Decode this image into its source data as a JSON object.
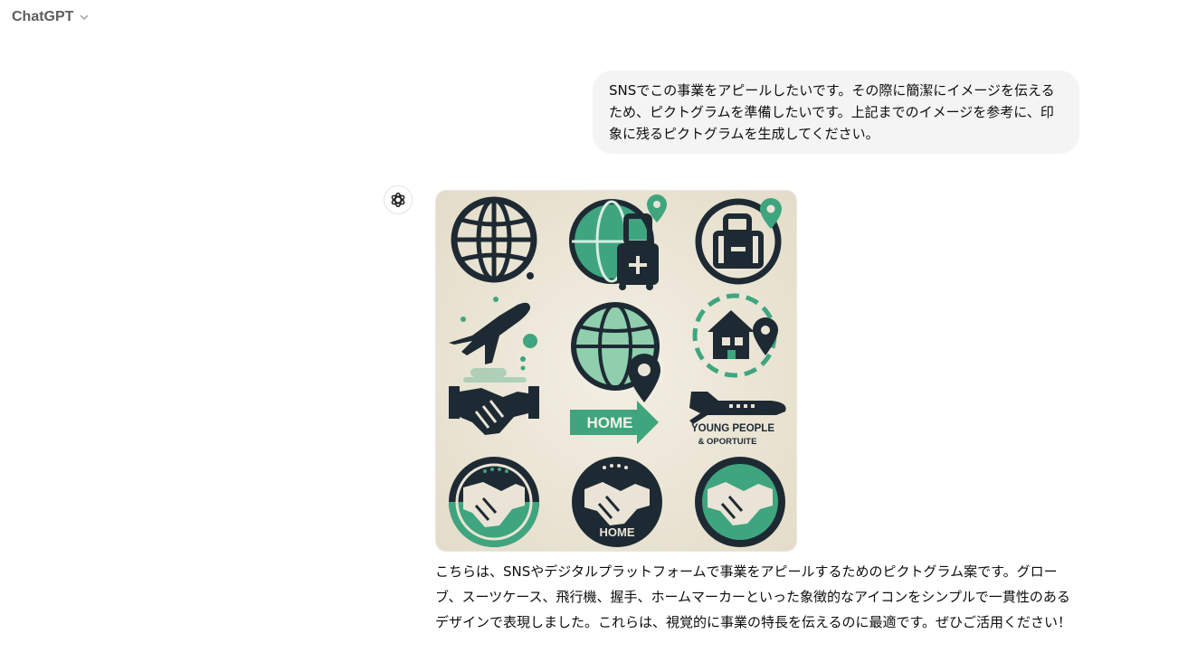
{
  "header": {
    "title": "ChatGPT",
    "chevron_icon": "chevron-down-icon"
  },
  "conversation": {
    "user_message": "SNSでこの事業をアピールしたいです。その際に簡潔にイメージを伝えるため、ピクトグラムを準備したいです。上記までのイメージを参考に、印象に残るピクトグラムを生成してください。",
    "assistant_avatar_icon": "openai-logo-icon",
    "image": {
      "labels": {
        "home_banner": "HOME",
        "young_people_line1": "YOUNG PEOPLE",
        "young_people_line2": "& OPORTUITE",
        "home_seal": "HOME"
      }
    },
    "assistant_message": "こちらは、SNSやデジタルプラットフォームで事業をアピールするためのピクトグラム案です。グローブ、スーツケース、飛行機、握手、ホームマーカーといった象徴的なアイコンをシンプルで一貫性のあるデザインで表現しました。これらは、視覚的に事業の特長を伝えるのに最適です。ぜひご活用ください！"
  },
  "colors": {
    "navy": "#1e2a33",
    "green": "#3fa57f",
    "background_cream": "#ece7d8",
    "bubble": "#f4f4f4"
  }
}
